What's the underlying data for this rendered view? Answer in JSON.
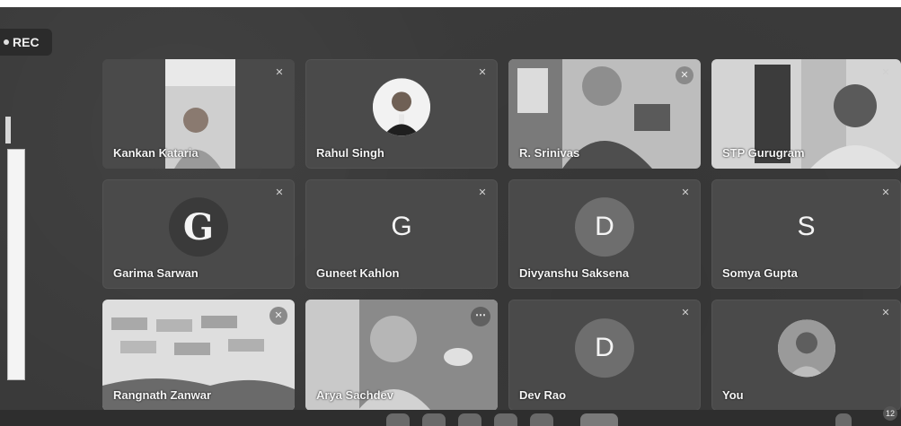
{
  "recording": {
    "label": "REC"
  },
  "participants": [
    {
      "name": "Kankan Kataria",
      "kind": "video"
    },
    {
      "name": "Rahul Singh",
      "kind": "photo-avatar"
    },
    {
      "name": "R. Srinivas",
      "kind": "video"
    },
    {
      "name": "STP Gurugram",
      "kind": "video"
    },
    {
      "name": "Garima Sarwan",
      "kind": "letter-avatar",
      "letter": "G"
    },
    {
      "name": "Guneet Kahlon",
      "kind": "letter-avatar",
      "letter": "G"
    },
    {
      "name": "Divyanshu Saksena",
      "kind": "letter-avatar",
      "letter": "D"
    },
    {
      "name": "Somya Gupta",
      "kind": "letter-avatar",
      "letter": "S"
    },
    {
      "name": "Rangnath Zanwar",
      "kind": "video"
    },
    {
      "name": "Arya Sachdev",
      "kind": "video"
    },
    {
      "name": "Dev Rao",
      "kind": "letter-avatar",
      "letter": "D"
    },
    {
      "name": "You",
      "kind": "photo-avatar"
    }
  ],
  "participant_count": "12",
  "icons": {
    "mic_off": "mic-off-icon",
    "more": "more-options-icon"
  }
}
